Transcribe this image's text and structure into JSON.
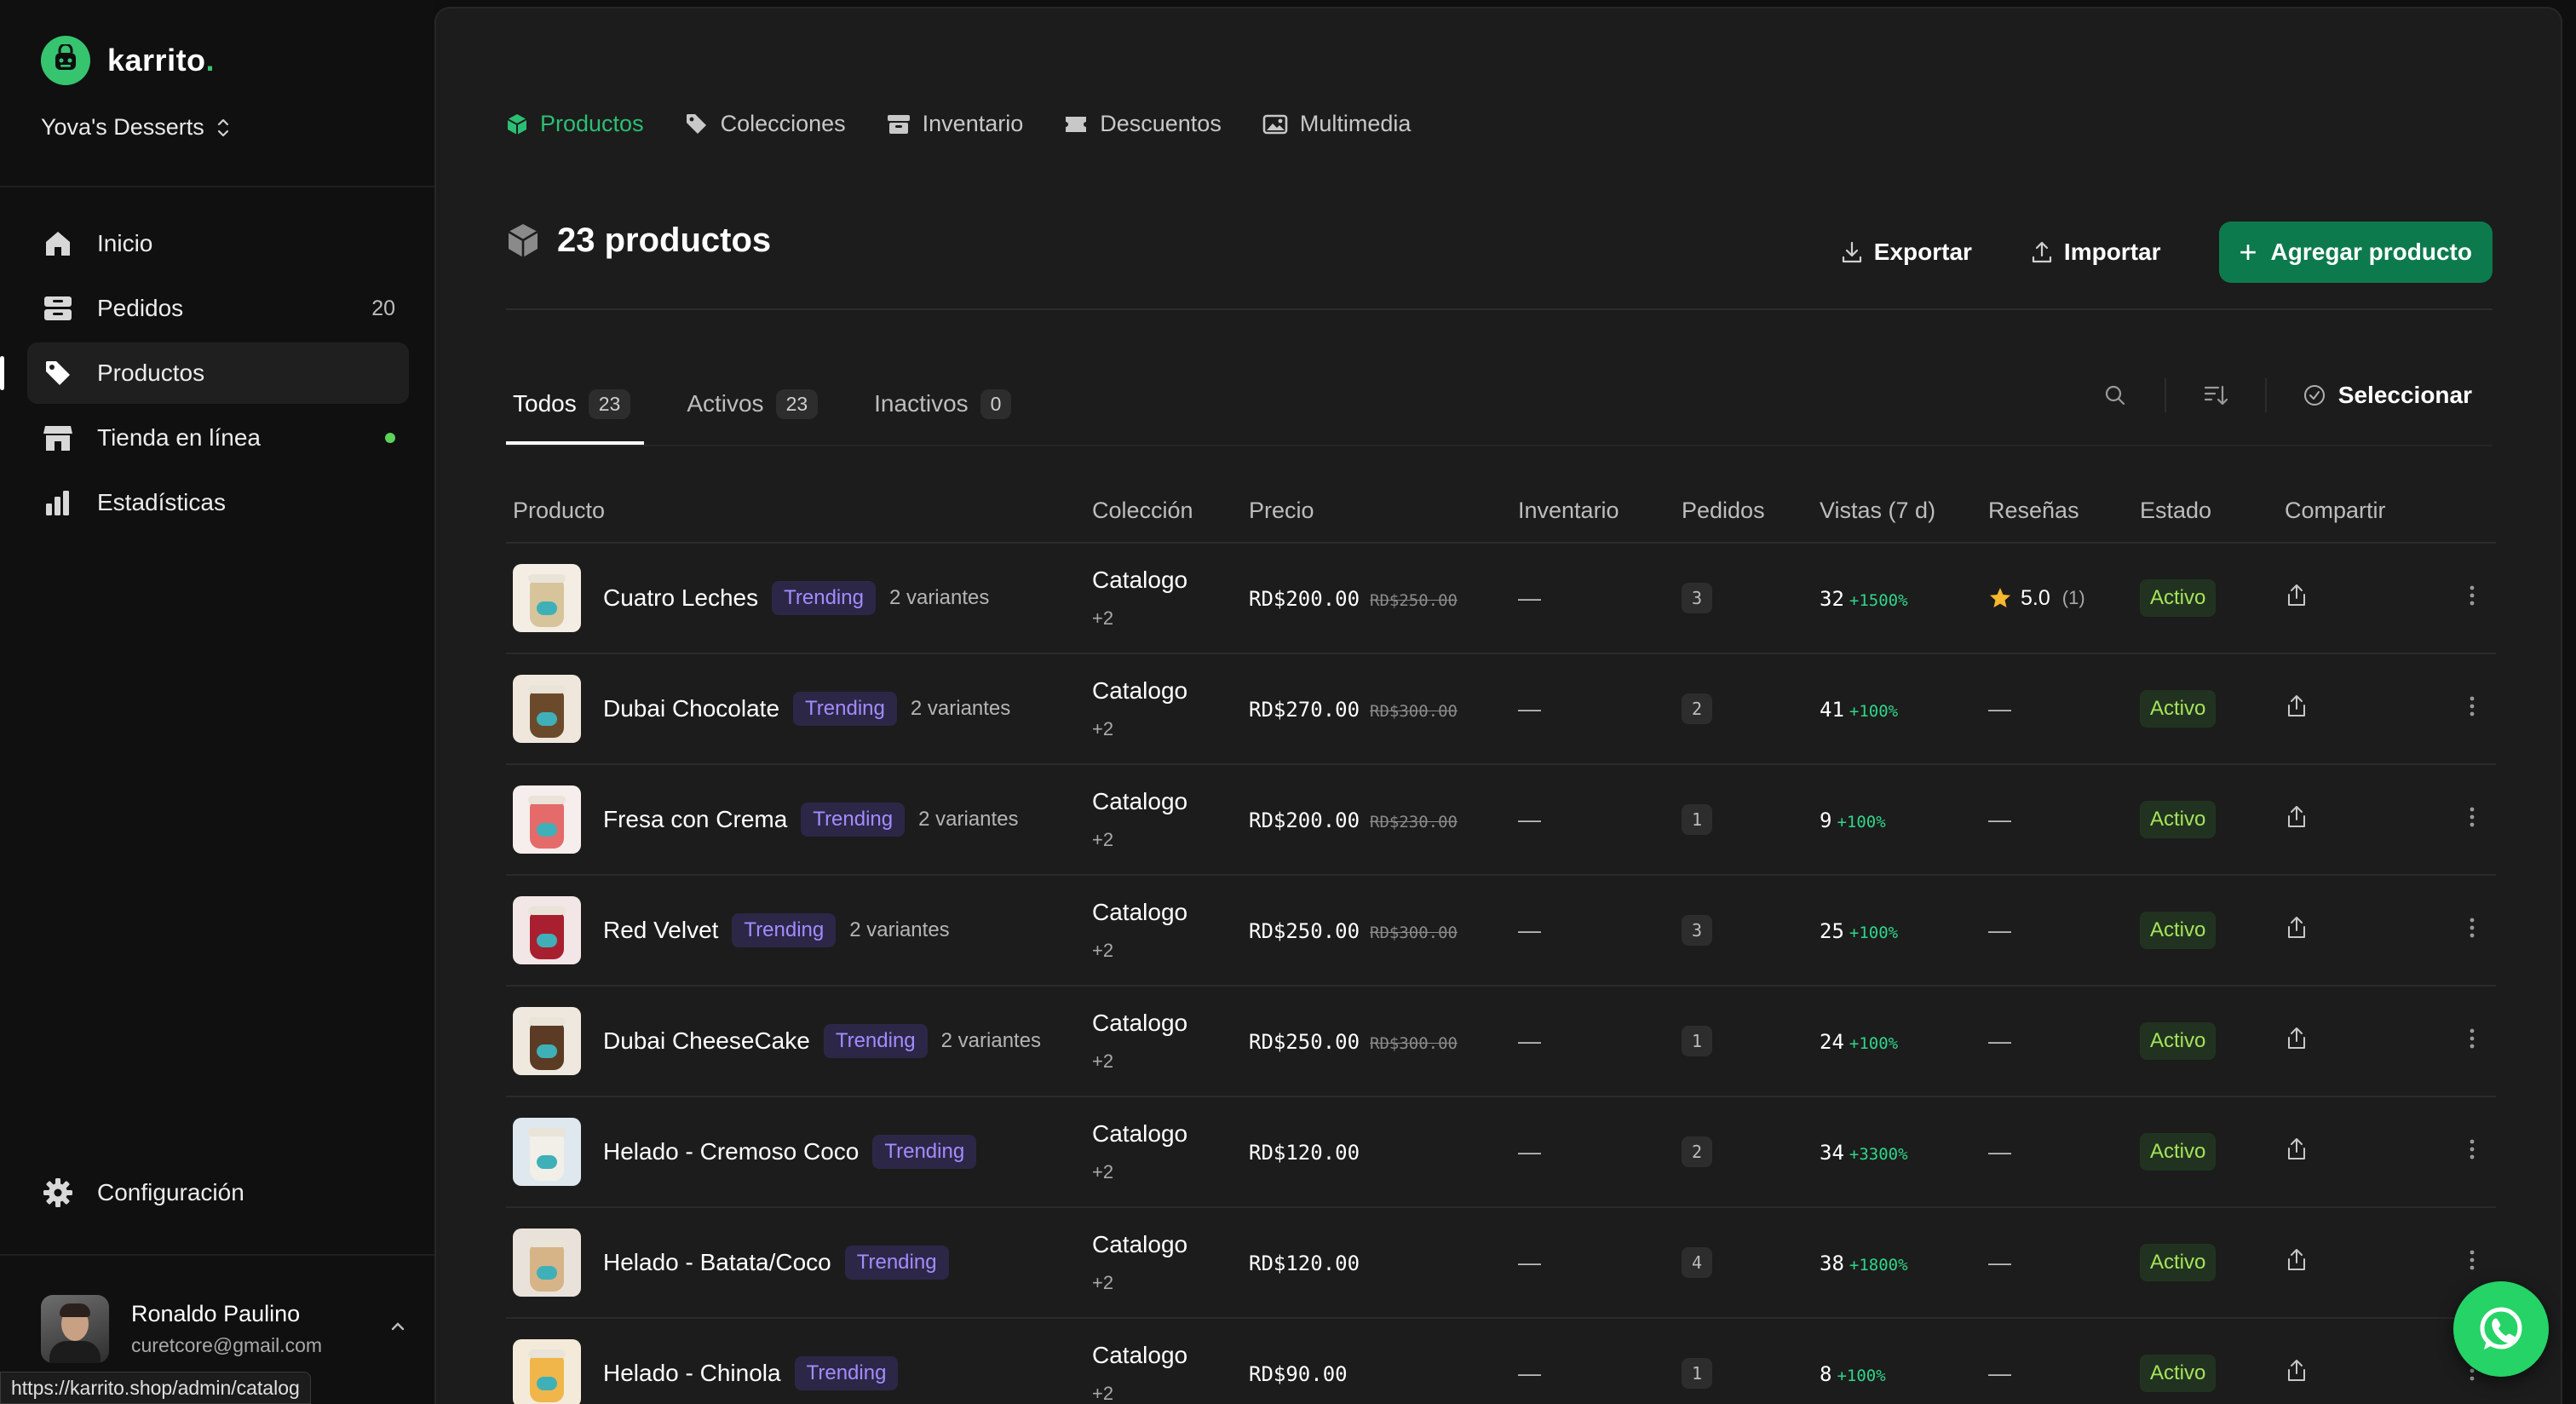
{
  "sidebar": {
    "brand": "karrito",
    "brand_dot": ".",
    "store": "Yova's Desserts",
    "nav": [
      {
        "label": "Inicio",
        "count": "",
        "icon": "home-icon"
      },
      {
        "label": "Pedidos",
        "count": "20",
        "icon": "inbox-icon"
      },
      {
        "label": "Productos",
        "count": "",
        "icon": "tag-icon"
      },
      {
        "label": "Tienda en línea",
        "count": "",
        "icon": "store-icon"
      },
      {
        "label": "Estadísticas",
        "count": "",
        "icon": "bar-chart-icon"
      }
    ],
    "settings": "Configuración",
    "user": {
      "name": "Ronaldo Paulino",
      "email": "curetcore@gmail.com"
    },
    "url_tooltip": "https://karrito.shop/admin/catalog"
  },
  "top_tabs": [
    "Productos",
    "Colecciones",
    "Inventario",
    "Descuentos",
    "Multimedia"
  ],
  "header": {
    "title": "23 productos",
    "export": "Exportar",
    "import": "Importar",
    "add": "Agregar producto"
  },
  "filters": [
    {
      "label": "Todos",
      "count": "23"
    },
    {
      "label": "Activos",
      "count": "23"
    },
    {
      "label": "Inactivos",
      "count": "0"
    }
  ],
  "select_label": "Seleccionar",
  "table": {
    "columns": [
      "Producto",
      "Colección",
      "Precio",
      "Inventario",
      "Pedidos",
      "Vistas (7 d)",
      "Reseñas",
      "Estado",
      "Compartir"
    ],
    "rows": [
      {
        "name": "Cuatro Leches",
        "tag": "Trending",
        "variants": "2 variantes",
        "collection": "Catalogo",
        "collection_more": "+2",
        "price": "RD$200.00",
        "price_old": "RD$250.00",
        "inventory": "—",
        "orders": "3",
        "views": "32",
        "views_delta": "+1500%",
        "rating": "5.0",
        "rating_count": "(1)",
        "state": "Activo"
      },
      {
        "name": "Dubai Chocolate",
        "tag": "Trending",
        "variants": "2 variantes",
        "collection": "Catalogo",
        "collection_more": "+2",
        "price": "RD$270.00",
        "price_old": "RD$300.00",
        "inventory": "—",
        "orders": "2",
        "views": "41",
        "views_delta": "+100%",
        "rating": "",
        "rating_count": "",
        "state": "Activo"
      },
      {
        "name": "Fresa con Crema",
        "tag": "Trending",
        "variants": "2 variantes",
        "collection": "Catalogo",
        "collection_more": "+2",
        "price": "RD$200.00",
        "price_old": "RD$230.00",
        "inventory": "—",
        "orders": "1",
        "views": "9",
        "views_delta": "+100%",
        "rating": "",
        "rating_count": "",
        "state": "Activo"
      },
      {
        "name": "Red Velvet",
        "tag": "Trending",
        "variants": "2 variantes",
        "collection": "Catalogo",
        "collection_more": "+2",
        "price": "RD$250.00",
        "price_old": "RD$300.00",
        "inventory": "—",
        "orders": "3",
        "views": "25",
        "views_delta": "+100%",
        "rating": "",
        "rating_count": "",
        "state": "Activo"
      },
      {
        "name": "Dubai CheeseCake",
        "tag": "Trending",
        "variants": "2 variantes",
        "collection": "Catalogo",
        "collection_more": "+2",
        "price": "RD$250.00",
        "price_old": "RD$300.00",
        "inventory": "—",
        "orders": "1",
        "views": "24",
        "views_delta": "+100%",
        "rating": "",
        "rating_count": "",
        "state": "Activo"
      },
      {
        "name": "Helado - Cremoso Coco",
        "tag": "Trending",
        "variants": "",
        "collection": "Catalogo",
        "collection_more": "+2",
        "price": "RD$120.00",
        "price_old": "",
        "inventory": "—",
        "orders": "2",
        "views": "34",
        "views_delta": "+3300%",
        "rating": "",
        "rating_count": "",
        "state": "Activo"
      },
      {
        "name": "Helado - Batata/Coco",
        "tag": "Trending",
        "variants": "",
        "collection": "Catalogo",
        "collection_more": "+2",
        "price": "RD$120.00",
        "price_old": "",
        "inventory": "—",
        "orders": "4",
        "views": "38",
        "views_delta": "+1800%",
        "rating": "",
        "rating_count": "",
        "state": "Activo"
      },
      {
        "name": "Helado - Chinola",
        "tag": "Trending",
        "variants": "",
        "collection": "Catalogo",
        "collection_more": "+2",
        "price": "RD$90.00",
        "price_old": "",
        "inventory": "—",
        "orders": "1",
        "views": "8",
        "views_delta": "+100%",
        "rating": "",
        "rating_count": "",
        "state": "Activo"
      }
    ],
    "empty_cell": "—"
  },
  "colors": {
    "accent": "#2bbf73",
    "primary_button": "#0d7a4e",
    "trending_text": "#a28cff",
    "status_active": "#a6e35a",
    "whatsapp": "#25d366"
  }
}
